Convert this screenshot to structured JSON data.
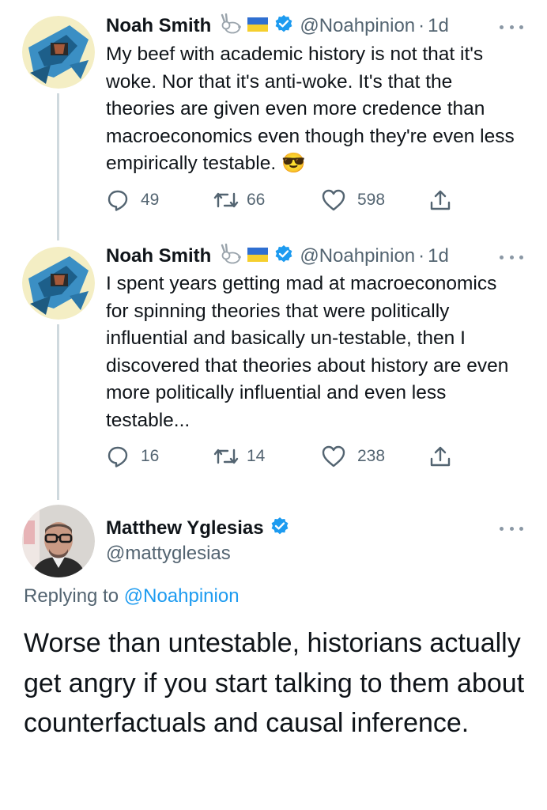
{
  "tweets": [
    {
      "name": "Noah Smith",
      "handle": "@Noahpinion",
      "sep": "·",
      "time": "1d",
      "text": "My beef with academic history is not that it's woke. Nor that it's anti-woke. It's that the theories are given even more credence than macroeconomics even though they're even less empirically testable. 😎",
      "replies": "49",
      "retweets": "66",
      "likes": "598"
    },
    {
      "name": "Noah Smith",
      "handle": "@Noahpinion",
      "sep": "·",
      "time": "1d",
      "text": "I spent years getting mad at macroeconomics for spinning theories that were politically influential and basically un-testable, then I discovered that theories about history are even more politically influential and even less testable...",
      "replies": "16",
      "retweets": "14",
      "likes": "238"
    }
  ],
  "main_tweet": {
    "name": "Matthew Yglesias",
    "handle": "@mattyglesias",
    "replying_label": "Replying to",
    "replying_handle": "@Noahpinion",
    "text": "Worse than untestable, historians actually get angry if you start talking to them about counterfactuals and causal inference."
  },
  "colors": {
    "verified": "#1d9bf0",
    "secondary_text": "#536471",
    "thread_line": "#cfd9de"
  },
  "icons": [
    "rabbit-emoji-icon",
    "ukraine-flag-icon",
    "verified-badge-icon",
    "more-icon",
    "reply-icon",
    "retweet-icon",
    "like-icon",
    "share-icon"
  ]
}
